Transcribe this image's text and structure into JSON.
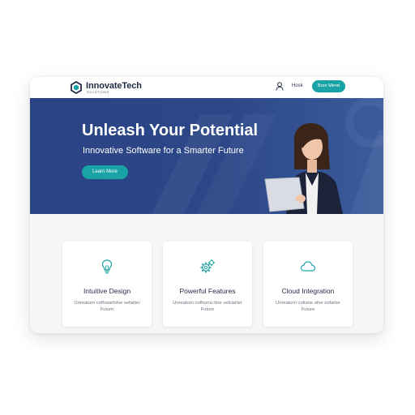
{
  "colors": {
    "accent": "#1aa3a6",
    "hero_bg": "#2c4788",
    "text_dark": "#1f2a44",
    "page_bg": "#f5f6f8"
  },
  "brand": {
    "name": "InnovateTech",
    "tagline": "SOLUTIONS",
    "logo_icon": "hexagon-logo-icon"
  },
  "nav": {
    "user_icon": "user-icon",
    "login_label": "Hosk",
    "cta_label": "Boor Mend"
  },
  "hero": {
    "title": "Unleash Your Potential",
    "subtitle": "Innovative Software for a Smarter Future",
    "cta_label": "Learn More"
  },
  "features": [
    {
      "icon": "lightbulb-icon",
      "title": "Intuitive Design",
      "description": "Unreaturn cofhwarfolve sefarter Futurn"
    },
    {
      "icon": "gears-icon",
      "title": "Powerful Features",
      "description": "Unreaturn cofhurra rbre velciarter Future"
    },
    {
      "icon": "cloud-icon",
      "title": "Cloud Integration",
      "description": "Unreaturn cofiane afve sofarter Future"
    }
  ]
}
